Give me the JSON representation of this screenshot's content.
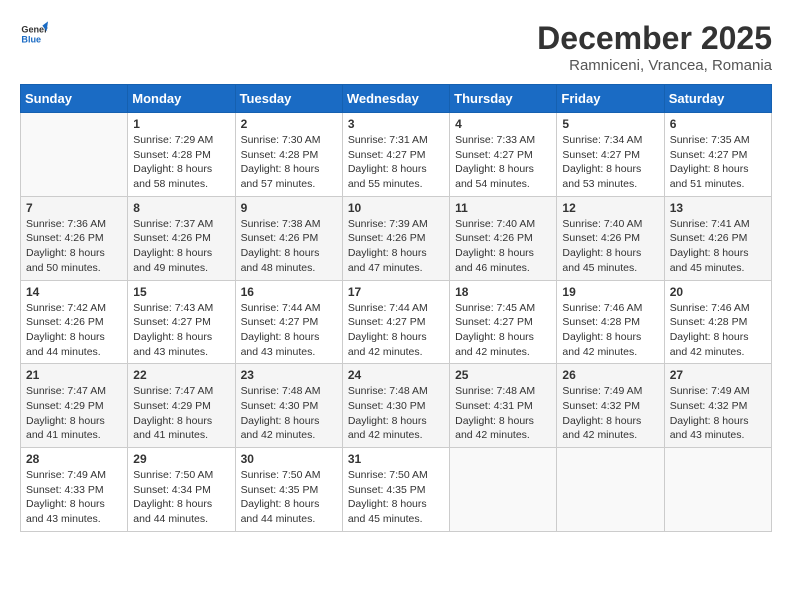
{
  "header": {
    "logo_general": "General",
    "logo_blue": "Blue",
    "month": "December 2025",
    "location": "Ramniceni, Vrancea, Romania"
  },
  "days_of_week": [
    "Sunday",
    "Monday",
    "Tuesday",
    "Wednesday",
    "Thursday",
    "Friday",
    "Saturday"
  ],
  "weeks": [
    [
      {
        "day": "",
        "sunrise": "",
        "sunset": "",
        "daylight": ""
      },
      {
        "day": "1",
        "sunrise": "Sunrise: 7:29 AM",
        "sunset": "Sunset: 4:28 PM",
        "daylight": "Daylight: 8 hours and 58 minutes."
      },
      {
        "day": "2",
        "sunrise": "Sunrise: 7:30 AM",
        "sunset": "Sunset: 4:28 PM",
        "daylight": "Daylight: 8 hours and 57 minutes."
      },
      {
        "day": "3",
        "sunrise": "Sunrise: 7:31 AM",
        "sunset": "Sunset: 4:27 PM",
        "daylight": "Daylight: 8 hours and 55 minutes."
      },
      {
        "day": "4",
        "sunrise": "Sunrise: 7:33 AM",
        "sunset": "Sunset: 4:27 PM",
        "daylight": "Daylight: 8 hours and 54 minutes."
      },
      {
        "day": "5",
        "sunrise": "Sunrise: 7:34 AM",
        "sunset": "Sunset: 4:27 PM",
        "daylight": "Daylight: 8 hours and 53 minutes."
      },
      {
        "day": "6",
        "sunrise": "Sunrise: 7:35 AM",
        "sunset": "Sunset: 4:27 PM",
        "daylight": "Daylight: 8 hours and 51 minutes."
      }
    ],
    [
      {
        "day": "7",
        "sunrise": "Sunrise: 7:36 AM",
        "sunset": "Sunset: 4:26 PM",
        "daylight": "Daylight: 8 hours and 50 minutes."
      },
      {
        "day": "8",
        "sunrise": "Sunrise: 7:37 AM",
        "sunset": "Sunset: 4:26 PM",
        "daylight": "Daylight: 8 hours and 49 minutes."
      },
      {
        "day": "9",
        "sunrise": "Sunrise: 7:38 AM",
        "sunset": "Sunset: 4:26 PM",
        "daylight": "Daylight: 8 hours and 48 minutes."
      },
      {
        "day": "10",
        "sunrise": "Sunrise: 7:39 AM",
        "sunset": "Sunset: 4:26 PM",
        "daylight": "Daylight: 8 hours and 47 minutes."
      },
      {
        "day": "11",
        "sunrise": "Sunrise: 7:40 AM",
        "sunset": "Sunset: 4:26 PM",
        "daylight": "Daylight: 8 hours and 46 minutes."
      },
      {
        "day": "12",
        "sunrise": "Sunrise: 7:40 AM",
        "sunset": "Sunset: 4:26 PM",
        "daylight": "Daylight: 8 hours and 45 minutes."
      },
      {
        "day": "13",
        "sunrise": "Sunrise: 7:41 AM",
        "sunset": "Sunset: 4:26 PM",
        "daylight": "Daylight: 8 hours and 45 minutes."
      }
    ],
    [
      {
        "day": "14",
        "sunrise": "Sunrise: 7:42 AM",
        "sunset": "Sunset: 4:26 PM",
        "daylight": "Daylight: 8 hours and 44 minutes."
      },
      {
        "day": "15",
        "sunrise": "Sunrise: 7:43 AM",
        "sunset": "Sunset: 4:27 PM",
        "daylight": "Daylight: 8 hours and 43 minutes."
      },
      {
        "day": "16",
        "sunrise": "Sunrise: 7:44 AM",
        "sunset": "Sunset: 4:27 PM",
        "daylight": "Daylight: 8 hours and 43 minutes."
      },
      {
        "day": "17",
        "sunrise": "Sunrise: 7:44 AM",
        "sunset": "Sunset: 4:27 PM",
        "daylight": "Daylight: 8 hours and 42 minutes."
      },
      {
        "day": "18",
        "sunrise": "Sunrise: 7:45 AM",
        "sunset": "Sunset: 4:27 PM",
        "daylight": "Daylight: 8 hours and 42 minutes."
      },
      {
        "day": "19",
        "sunrise": "Sunrise: 7:46 AM",
        "sunset": "Sunset: 4:28 PM",
        "daylight": "Daylight: 8 hours and 42 minutes."
      },
      {
        "day": "20",
        "sunrise": "Sunrise: 7:46 AM",
        "sunset": "Sunset: 4:28 PM",
        "daylight": "Daylight: 8 hours and 42 minutes."
      }
    ],
    [
      {
        "day": "21",
        "sunrise": "Sunrise: 7:47 AM",
        "sunset": "Sunset: 4:29 PM",
        "daylight": "Daylight: 8 hours and 41 minutes."
      },
      {
        "day": "22",
        "sunrise": "Sunrise: 7:47 AM",
        "sunset": "Sunset: 4:29 PM",
        "daylight": "Daylight: 8 hours and 41 minutes."
      },
      {
        "day": "23",
        "sunrise": "Sunrise: 7:48 AM",
        "sunset": "Sunset: 4:30 PM",
        "daylight": "Daylight: 8 hours and 42 minutes."
      },
      {
        "day": "24",
        "sunrise": "Sunrise: 7:48 AM",
        "sunset": "Sunset: 4:30 PM",
        "daylight": "Daylight: 8 hours and 42 minutes."
      },
      {
        "day": "25",
        "sunrise": "Sunrise: 7:48 AM",
        "sunset": "Sunset: 4:31 PM",
        "daylight": "Daylight: 8 hours and 42 minutes."
      },
      {
        "day": "26",
        "sunrise": "Sunrise: 7:49 AM",
        "sunset": "Sunset: 4:32 PM",
        "daylight": "Daylight: 8 hours and 42 minutes."
      },
      {
        "day": "27",
        "sunrise": "Sunrise: 7:49 AM",
        "sunset": "Sunset: 4:32 PM",
        "daylight": "Daylight: 8 hours and 43 minutes."
      }
    ],
    [
      {
        "day": "28",
        "sunrise": "Sunrise: 7:49 AM",
        "sunset": "Sunset: 4:33 PM",
        "daylight": "Daylight: 8 hours and 43 minutes."
      },
      {
        "day": "29",
        "sunrise": "Sunrise: 7:50 AM",
        "sunset": "Sunset: 4:34 PM",
        "daylight": "Daylight: 8 hours and 44 minutes."
      },
      {
        "day": "30",
        "sunrise": "Sunrise: 7:50 AM",
        "sunset": "Sunset: 4:35 PM",
        "daylight": "Daylight: 8 hours and 44 minutes."
      },
      {
        "day": "31",
        "sunrise": "Sunrise: 7:50 AM",
        "sunset": "Sunset: 4:35 PM",
        "daylight": "Daylight: 8 hours and 45 minutes."
      },
      {
        "day": "",
        "sunrise": "",
        "sunset": "",
        "daylight": ""
      },
      {
        "day": "",
        "sunrise": "",
        "sunset": "",
        "daylight": ""
      },
      {
        "day": "",
        "sunrise": "",
        "sunset": "",
        "daylight": ""
      }
    ]
  ]
}
